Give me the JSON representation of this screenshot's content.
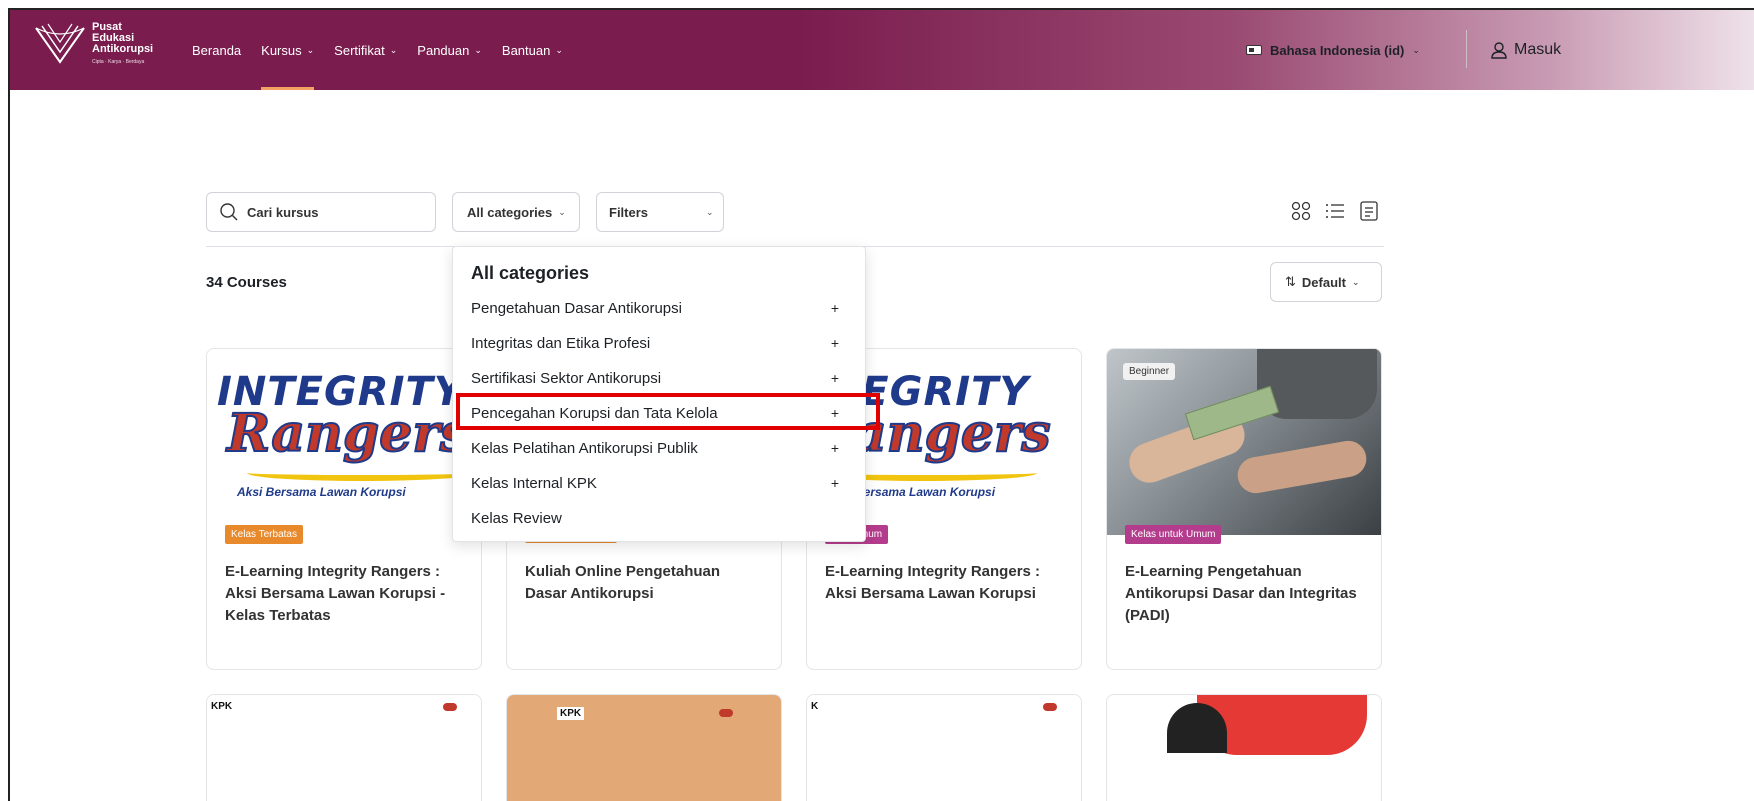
{
  "navbar": {
    "logo": {
      "line1": "Pusat",
      "line2": "Edukasi",
      "line3": "Antikorupsi",
      "tagline": "Cipta · Karya · Berdaya"
    },
    "items": [
      {
        "label": "Beranda",
        "has_menu": false,
        "active": false
      },
      {
        "label": "Kursus",
        "has_menu": true,
        "active": true
      },
      {
        "label": "Sertifikat",
        "has_menu": true,
        "active": false
      },
      {
        "label": "Panduan",
        "has_menu": true,
        "active": false
      },
      {
        "label": "Bantuan",
        "has_menu": true,
        "active": false
      }
    ],
    "language": "Bahasa Indonesia (id)",
    "login": "Masuk"
  },
  "controls": {
    "search_label": "Cari kursus",
    "categories_label": "All categories",
    "filters_label": "Filters",
    "sort_label": "Default",
    "course_count": "34 Courses"
  },
  "dropdown": {
    "title": "All categories",
    "items": [
      {
        "label": "Pengetahuan Dasar Antikorupsi",
        "expand": "+"
      },
      {
        "label": "Integritas dan Etika Profesi",
        "expand": "+"
      },
      {
        "label": "Sertifikasi Sektor Antikorupsi",
        "expand": "+"
      },
      {
        "label": "Pencegahan Korupsi dan Tata Kelola",
        "expand": "+"
      },
      {
        "label": "Kelas Pelatihan Antikorupsi Publik",
        "expand": "+"
      },
      {
        "label": "Kelas Internal KPK",
        "expand": "+"
      },
      {
        "label": "Kelas Review",
        "expand": ""
      }
    ],
    "highlighted_index": 3
  },
  "courses": [
    {
      "badge": "Kelas Terbatas",
      "title": "E-Learning Integrity Rangers : Aksi Bersama Lawan Korupsi - Kelas Terbatas",
      "image_text": {
        "top": "INTEGRITY",
        "middle": "Rangers",
        "tag": "Aksi Bersama Lawan Korupsi"
      }
    },
    {
      "badge": "",
      "title": "Kuliah Online Pengetahuan Dasar Antikorupsi"
    },
    {
      "badge": "ntuk Umum",
      "title": "E-Learning Integrity Rangers : Aksi Bersama Lawan Korupsi",
      "image_text": {
        "top": "TEGRITY",
        "middle": "angers",
        "tag": "ksi Bersama Lawan Korupsi"
      }
    },
    {
      "badge": "Kelas untuk Umum",
      "level": "Beginner",
      "title": "E-Learning Pengetahuan Antikorupsi Dasar dan Integritas (PADI)"
    }
  ],
  "peek_cards": [
    "KPK",
    "KPK",
    "K"
  ],
  "colors": {
    "brand": "#7a1c4e",
    "badge_orange": "#e8892b",
    "badge_magenta": "#b43c8c",
    "highlight": "#e00000"
  }
}
